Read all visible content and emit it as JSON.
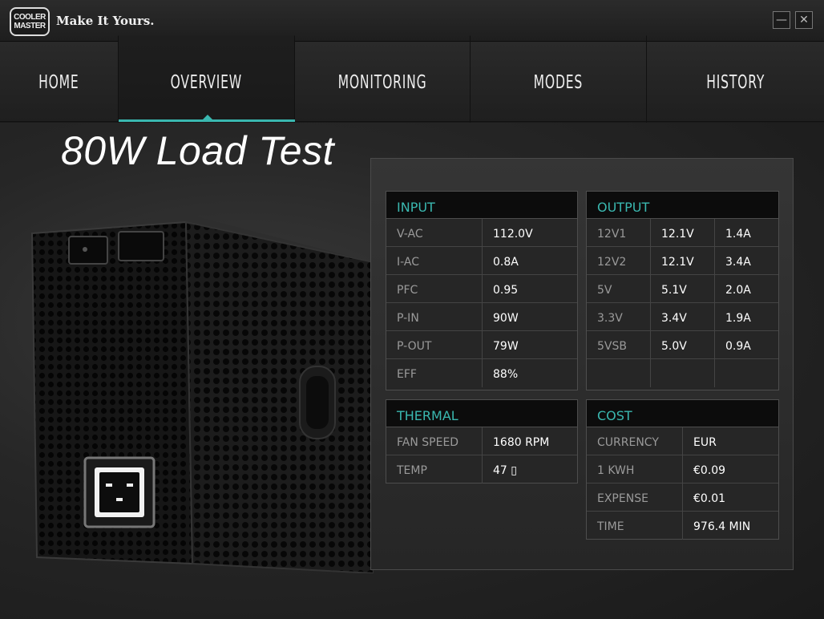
{
  "app": {
    "logo_line1": "COOLER",
    "logo_line2": "MASTER",
    "tagline": "Make It Yours.",
    "minimize_glyph": "—",
    "close_glyph": "✕"
  },
  "nav": {
    "tabs": [
      "HOME",
      "OVERVIEW",
      "MONITORING",
      "MODES",
      "HISTORY"
    ],
    "active": "OVERVIEW",
    "accent_color": "#3ab8b0"
  },
  "main": {
    "title": "80W Load Test"
  },
  "input": {
    "header": "INPUT",
    "rows": [
      {
        "label": "V-AC",
        "value": "112.0V"
      },
      {
        "label": "I-AC",
        "value": "0.8A"
      },
      {
        "label": "PFC",
        "value": "0.95"
      },
      {
        "label": "P-IN",
        "value": "90W"
      },
      {
        "label": "P-OUT",
        "value": "79W"
      },
      {
        "label": "EFF",
        "value": "88%"
      }
    ]
  },
  "output": {
    "header": "OUTPUT",
    "rows": [
      {
        "label": "12V1",
        "voltage": "12.1V",
        "current": "1.4A"
      },
      {
        "label": "12V2",
        "voltage": "12.1V",
        "current": "3.4A"
      },
      {
        "label": "5V",
        "voltage": "5.1V",
        "current": "2.0A"
      },
      {
        "label": "3.3V",
        "voltage": "3.4V",
        "current": "1.9A"
      },
      {
        "label": "5VSB",
        "voltage": "5.0V",
        "current": "0.9A"
      },
      {
        "label": "",
        "voltage": "",
        "current": ""
      }
    ]
  },
  "thermal": {
    "header": "THERMAL",
    "rows": [
      {
        "label": "FAN SPEED",
        "value": "1680 RPM"
      },
      {
        "label": "TEMP",
        "value": "47 ▯"
      }
    ]
  },
  "cost": {
    "header": "COST",
    "rows": [
      {
        "label": "CURRENCY",
        "value": "EUR"
      },
      {
        "label": "1 KWH",
        "value": "€0.09"
      },
      {
        "label": "EXPENSE",
        "value": "€0.01"
      },
      {
        "label": "TIME",
        "value": "976.4 MIN"
      }
    ]
  }
}
